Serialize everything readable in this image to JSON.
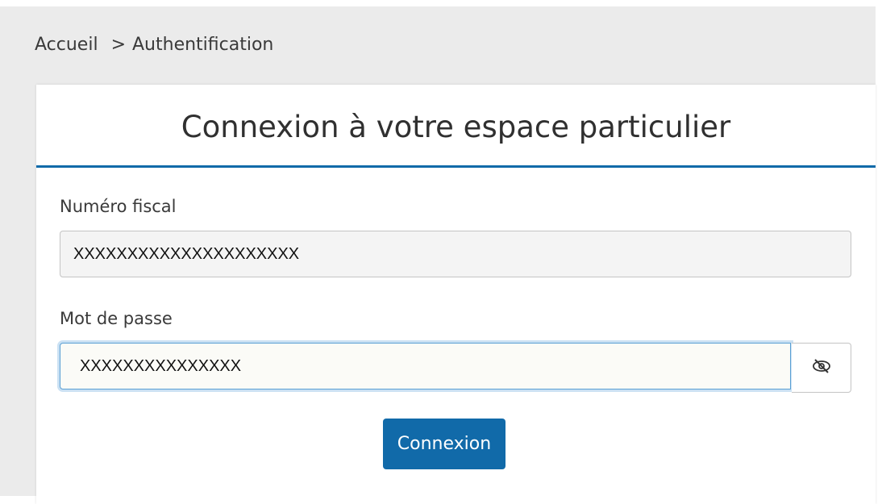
{
  "breadcrumb": {
    "home": "Accueil",
    "separator": ">",
    "current": "Authentification"
  },
  "login_card": {
    "title": "Connexion à votre espace particulier",
    "fiscal_number": {
      "label": "Numéro fiscal",
      "value": "XXXXXXXXXXXXXXXXXXXXX"
    },
    "password": {
      "label": "Mot de passe",
      "value": "XXXXXXXXXXXXXXX",
      "reveal_icon": "eye-slash-icon"
    },
    "submit_label": "Connexion"
  },
  "colors": {
    "accent": "#116aa9",
    "header_rule": "#0f6aa8",
    "page_background": "#ebebeb",
    "focus_ring": "#6ba9de"
  }
}
